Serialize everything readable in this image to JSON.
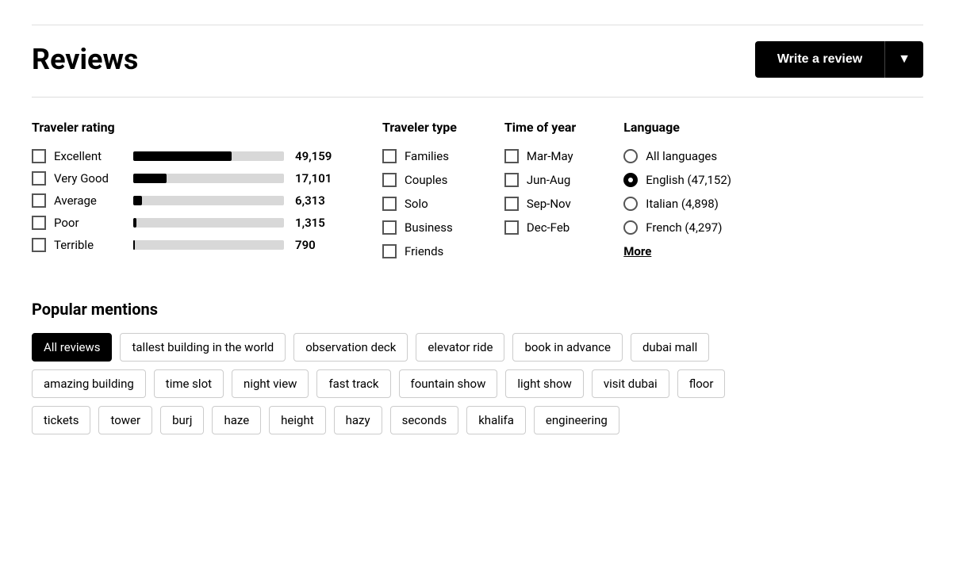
{
  "header": {
    "title": "Reviews",
    "write_review_label": "Write a review",
    "dropdown_arrow": "▼"
  },
  "traveler_rating": {
    "title": "Traveler rating",
    "ratings": [
      {
        "label": "Excellent",
        "count": "49,159",
        "bar_pct": 65
      },
      {
        "label": "Very Good",
        "count": "17,101",
        "bar_pct": 22
      },
      {
        "label": "Average",
        "count": "6,313",
        "bar_pct": 6
      },
      {
        "label": "Poor",
        "count": "1,315",
        "bar_pct": 2
      },
      {
        "label": "Terrible",
        "count": "790",
        "bar_pct": 1
      }
    ]
  },
  "traveler_type": {
    "title": "Traveler type",
    "types": [
      "Families",
      "Couples",
      "Solo",
      "Business",
      "Friends"
    ]
  },
  "time_of_year": {
    "title": "Time of year",
    "times": [
      "Mar-May",
      "Jun-Aug",
      "Sep-Nov",
      "Dec-Feb"
    ]
  },
  "language": {
    "title": "Language",
    "options": [
      {
        "label": "All languages",
        "count": "",
        "selected": false
      },
      {
        "label": "English (47,152)",
        "count": "",
        "selected": true
      },
      {
        "label": "Italian (4,898)",
        "count": "",
        "selected": false
      },
      {
        "label": "French (4,297)",
        "count": "",
        "selected": false
      }
    ],
    "more_label": "More"
  },
  "popular_mentions": {
    "title": "Popular mentions",
    "tags_row1": [
      {
        "label": "All reviews",
        "active": true
      },
      {
        "label": "tallest building in the world",
        "active": false
      },
      {
        "label": "observation deck",
        "active": false
      },
      {
        "label": "elevator ride",
        "active": false
      },
      {
        "label": "book in advance",
        "active": false
      },
      {
        "label": "dubai mall",
        "active": false
      }
    ],
    "tags_row2": [
      {
        "label": "amazing building",
        "active": false
      },
      {
        "label": "time slot",
        "active": false
      },
      {
        "label": "night view",
        "active": false
      },
      {
        "label": "fast track",
        "active": false
      },
      {
        "label": "fountain show",
        "active": false
      },
      {
        "label": "light show",
        "active": false
      },
      {
        "label": "visit dubai",
        "active": false
      },
      {
        "label": "floor",
        "active": false
      }
    ],
    "tags_row3": [
      {
        "label": "tickets",
        "active": false
      },
      {
        "label": "tower",
        "active": false
      },
      {
        "label": "burj",
        "active": false
      },
      {
        "label": "haze",
        "active": false
      },
      {
        "label": "height",
        "active": false
      },
      {
        "label": "hazy",
        "active": false
      },
      {
        "label": "seconds",
        "active": false
      },
      {
        "label": "khalifa",
        "active": false
      },
      {
        "label": "engineering",
        "active": false
      }
    ]
  }
}
